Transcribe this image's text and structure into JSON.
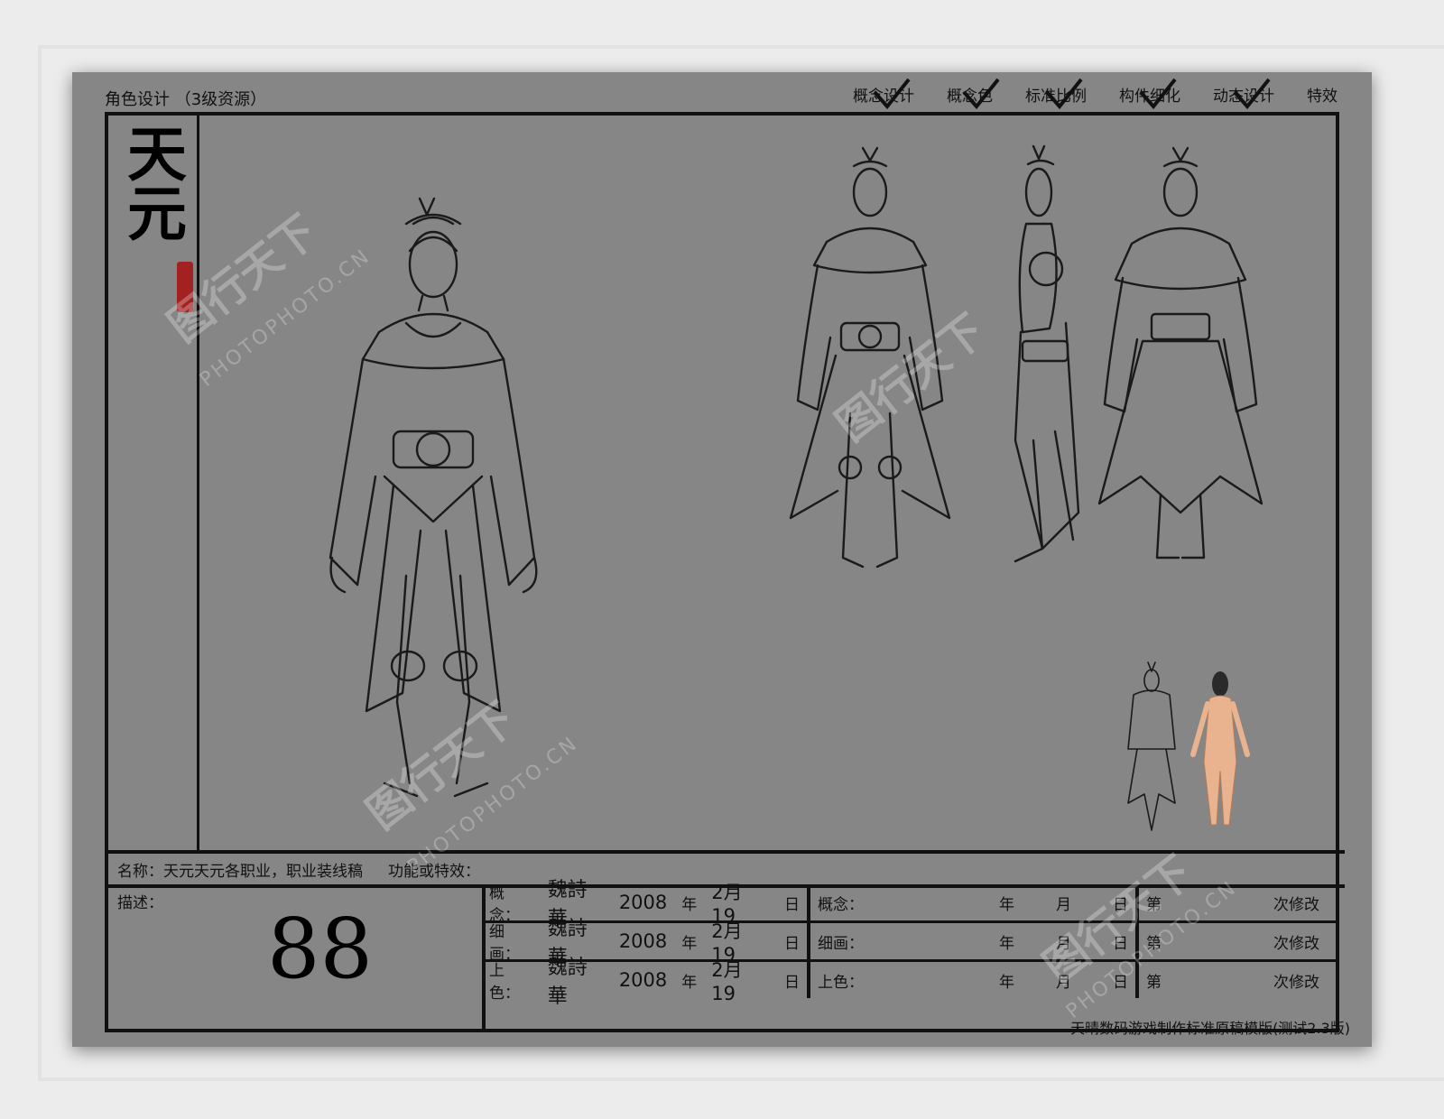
{
  "header": {
    "title": "角色设计 （3级资源）",
    "stages": [
      "概念设计",
      "概念色",
      "标准比例",
      "构件细化",
      "动态设计",
      "特效"
    ]
  },
  "logo": {
    "text": "天元"
  },
  "info": {
    "name_label": "名称：",
    "name_value": "天元天元各职业，职业装线稿",
    "function_label": "功能或特效：",
    "desc_label": "描述：",
    "desc_value": "88"
  },
  "signoff": [
    {
      "label": "概念：",
      "signer": "魏詩華",
      "year": "2008",
      "year_unit": "年",
      "month_day": "2月 19",
      "day_unit": "日"
    },
    {
      "label": "细画：",
      "signer": "魏詩華",
      "year": "2008",
      "year_unit": "年",
      "month_day": "2月 19",
      "day_unit": "日"
    },
    {
      "label": "上色：",
      "signer": "魏詩華",
      "year": "2008",
      "year_unit": "年",
      "month_day": "2月 19",
      "day_unit": "日"
    }
  ],
  "revision": [
    {
      "label": "概念：",
      "y": "年",
      "m": "月",
      "d": "日",
      "nth": "第",
      "times": "次修改"
    },
    {
      "label": "细画：",
      "y": "年",
      "m": "月",
      "d": "日",
      "nth": "第",
      "times": "次修改"
    },
    {
      "label": "上色：",
      "y": "年",
      "m": "月",
      "d": "日",
      "nth": "第",
      "times": "次修改"
    }
  ],
  "footer": "天晴数码游戏制作标准原稿模版(测试2.3版)",
  "watermark": {
    "text": "图行天下",
    "sub": "PHOTOPHOTO.CN"
  },
  "colors": {
    "sheet": "#868686",
    "line": "#111111",
    "seal": "#a32121",
    "skin": "#e9b38f"
  }
}
